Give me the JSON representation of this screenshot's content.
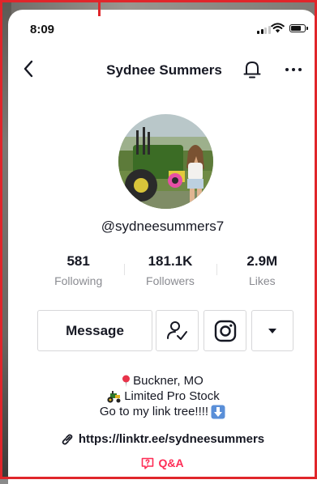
{
  "status_bar": {
    "time": "8:09",
    "signal_bars": 4,
    "signal_bars_on": 2,
    "battery_level": 0.8
  },
  "nav": {
    "title": "Sydnee Summers",
    "back_icon": "chevron-left-icon",
    "bell_icon": "bell-icon",
    "more_icon": "more-dots-icon"
  },
  "profile": {
    "username": "@sydneesummers7"
  },
  "stats": [
    {
      "value": "581",
      "label": "Following"
    },
    {
      "value": "181.1K",
      "label": "Followers"
    },
    {
      "value": "2.9M",
      "label": "Likes"
    }
  ],
  "actions": {
    "message_label": "Message",
    "friend_icon": "person-check-icon",
    "instagram_icon": "instagram-icon",
    "dropdown_icon": "caret-down-icon"
  },
  "bio": {
    "line1": "Buckner, MO",
    "line1_icon": "pin-icon",
    "line2": "Limited Pro Stock",
    "line2_icon": "tractor-icon",
    "line3": "Go to my link tree!!!!",
    "line3_icon": "down-arrow-icon",
    "link": "https://linktr.ee/sydneesummers",
    "link_icon": "link-icon",
    "qa_label": "Q&A",
    "qa_icon": "question-box-icon"
  },
  "colors": {
    "accent": "#fe2c55",
    "text": "#161823",
    "muted": "#8a8b91",
    "frame": "#e0262b"
  }
}
